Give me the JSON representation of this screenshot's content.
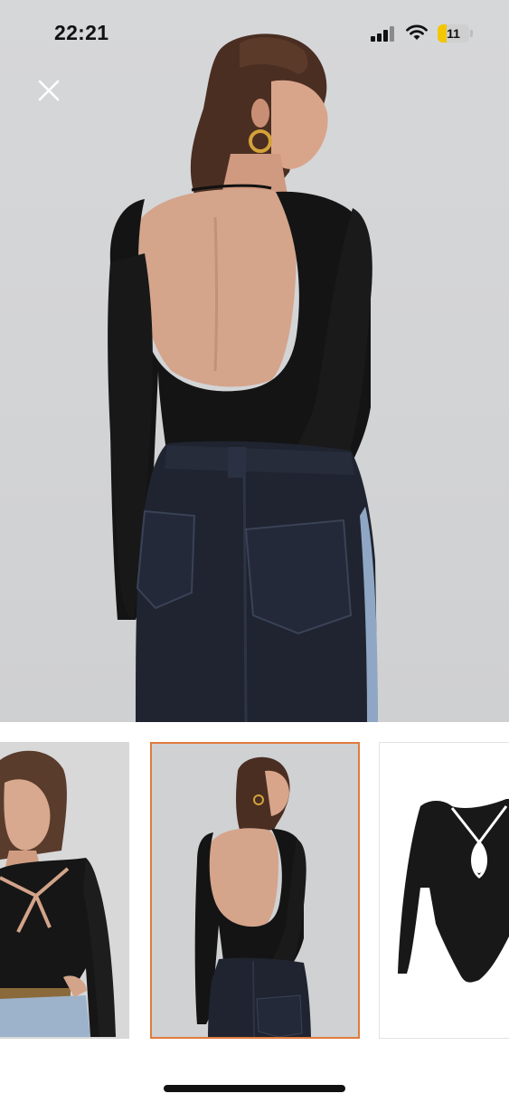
{
  "status_bar": {
    "time": "22:21",
    "battery_level": "11",
    "battery_fraction": 0.11,
    "icons": [
      "signal-icon",
      "wifi-icon",
      "battery-icon"
    ]
  },
  "viewer": {
    "close_icon": "close-icon",
    "main_image_subject": "back-view-black-bodysuit-model",
    "selected_thumbnail_index": 1,
    "accent_color": "#e07b3c"
  },
  "thumbnails": [
    {
      "subject": "front-view-model-bodysuit"
    },
    {
      "subject": "back-view-model-bodysuit"
    },
    {
      "subject": "product-bodysuit-flat"
    }
  ]
}
